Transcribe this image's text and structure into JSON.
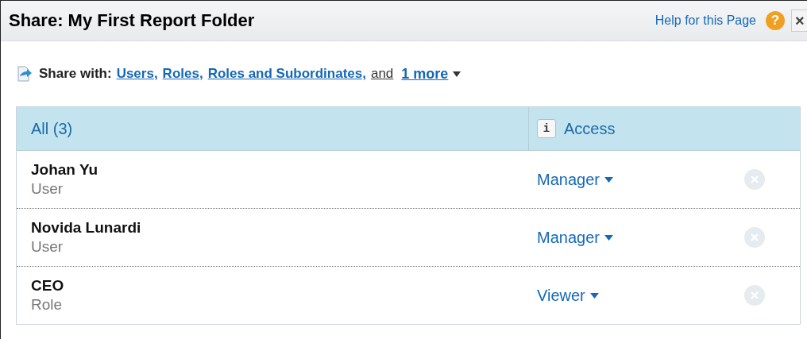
{
  "window": {
    "title": "Share: My First Report Folder",
    "help_link": "Help for this Page",
    "help_icon": "?",
    "close": "×"
  },
  "share_with": {
    "label": "Share with:",
    "options": [
      {
        "text": "Users,",
        "kind": "link"
      },
      {
        "text": "Roles,",
        "kind": "link"
      },
      {
        "text": "Roles and Subordinates,",
        "kind": "link"
      },
      {
        "text": "and",
        "kind": "plain"
      },
      {
        "text": "1 more",
        "kind": "more"
      }
    ]
  },
  "table": {
    "columns": [
      "All (3)",
      "Access"
    ],
    "info_icon": "i",
    "rows": [
      {
        "name": "Johan Yu",
        "type": "User",
        "access": "Manager"
      },
      {
        "name": "Novida Lunardi",
        "type": "User",
        "access": "Manager"
      },
      {
        "name": "CEO",
        "type": "Role",
        "access": "Viewer"
      }
    ]
  }
}
